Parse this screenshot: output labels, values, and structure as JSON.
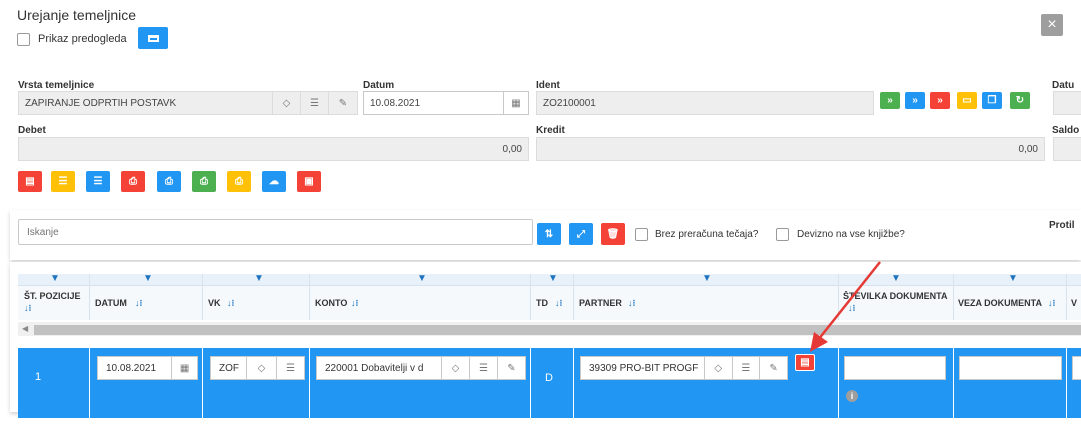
{
  "header": {
    "title": "Urejanje temeljnice",
    "preview_label": "Prikaz predogleda"
  },
  "form": {
    "vrsta_label": "Vrsta temeljnice",
    "vrsta_value": "ZAPIRANJE ODPRTIH POSTAVK",
    "datum_label": "Datum",
    "datum_value": "10.08.2021",
    "ident_label": "Ident",
    "ident_value": "ZO2100001",
    "datu_label": "Datu",
    "debet_label": "Debet",
    "debet_value": "0,00",
    "kredit_label": "Kredit",
    "kredit_value": "0,00",
    "saldo_label": "Saldo"
  },
  "search": {
    "placeholder": "Iskanje",
    "brez_label": "Brez preračuna tečaja?",
    "devizno_label": "Devizno na vse knjižbe?",
    "protil_label": "Protil"
  },
  "table": {
    "headers": {
      "st_pozicije": "ŠT. POZICIJE",
      "datum": "DATUM",
      "vk": "VK",
      "konto": "KONTO",
      "td": "TD",
      "partner": "PARTNER",
      "stevilka_dokumenta": "ŠTEVILKA DOKUMENTA",
      "veza_dokumenta": "VEZA DOKUMENTA",
      "v": "V"
    },
    "sort_glyph": "↓⁝",
    "row": {
      "pos": "1",
      "datum": "10.08.2021",
      "vk": "ZOF",
      "konto": "220001 Dobavitelji v d",
      "td": "D",
      "partner": "39309 PRO-BIT PROGF"
    }
  },
  "colors": {
    "accent_blue": "#2196f3",
    "red": "#f44336",
    "yellow": "#ffc107",
    "green": "#4caf50",
    "arrow": "#e53935"
  }
}
